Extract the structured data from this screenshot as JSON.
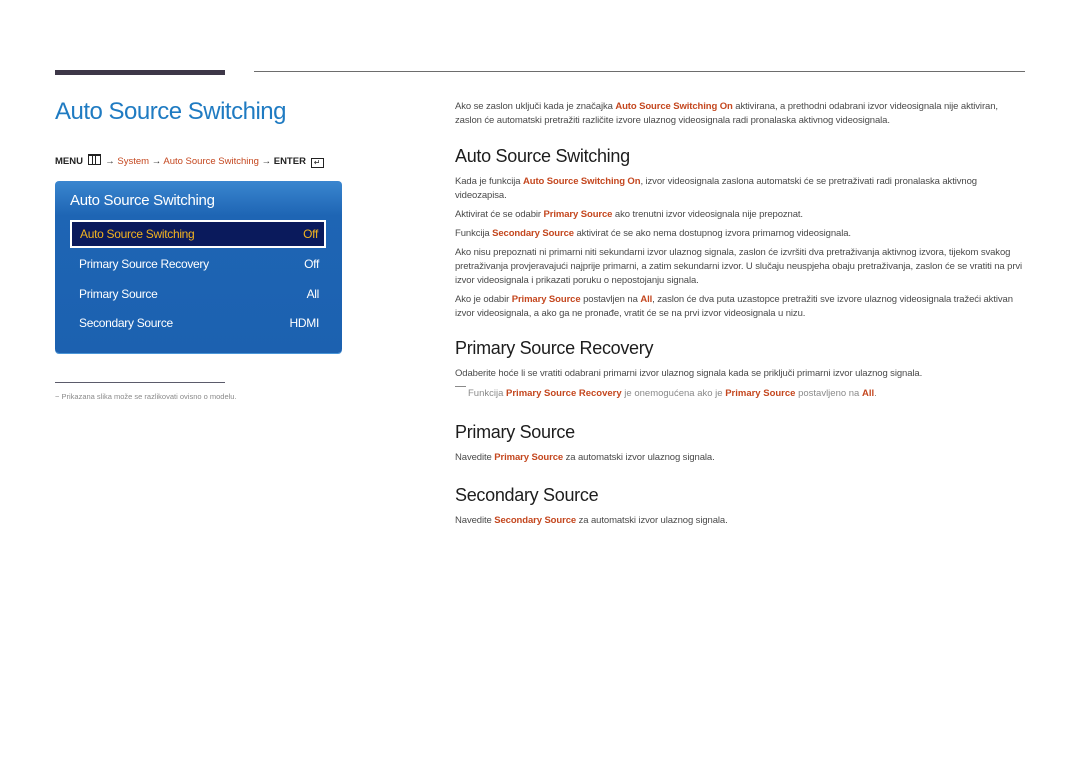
{
  "page": {
    "title": "Auto Source Switching",
    "menu_path": {
      "menu": "MENU",
      "menu_icon": "menu-grid-icon",
      "arrow": "→",
      "system": "System",
      "item": "Auto Source Switching",
      "enter": "ENTER",
      "enter_icon": "enter-return-icon",
      "enter_glyph": "↵"
    }
  },
  "osd": {
    "title": "Auto Source Switching",
    "rows": [
      {
        "label": "Auto Source Switching",
        "value": "Off",
        "selected": true
      },
      {
        "label": "Primary Source Recovery",
        "value": "Off",
        "selected": false
      },
      {
        "label": "Primary Source",
        "value": "All",
        "selected": false
      },
      {
        "label": "Secondary Source",
        "value": "HDMI",
        "selected": false
      }
    ],
    "colors": {
      "panel": "#1e65b4",
      "selected_bg": "#0a1a5c",
      "selected_text": "#f3b320"
    }
  },
  "footnote": "Prikazana slika može se razlikovati ovisno o modelu.",
  "footnote_dash": "−",
  "content": {
    "intro": {
      "t1": "Ako se zaslon uključi kada je značajka ",
      "h1": "Auto Source Switching On",
      "t2": " aktivirana, a prethodni odabrani izvor videosignala nije aktiviran, zaslon će automatski pretražiti različite izvore ulaznog videosignala radi pronalaska aktivnog videosignala."
    },
    "sections": {
      "ass": {
        "heading": "Auto Source Switching",
        "p1": {
          "t1": "Kada je funkcija ",
          "h1": "Auto Source Switching On",
          "t2": ", izvor videosignala zaslona automatski će se pretraživati radi pronalaska aktivnog videozapisa."
        },
        "p2": {
          "t1": "Aktivirat će se odabir ",
          "h1": "Primary Source",
          "t2": " ako trenutni izvor videosignala nije prepoznat."
        },
        "p3": {
          "t1": "Funkcija ",
          "h1": "Secondary Source",
          "t2": " aktivirat će se ako nema dostupnog izvora primarnog videosignala."
        },
        "p4": {
          "t1": "Ako nisu prepoznati ni primarni niti sekundarni izvor ulaznog signala, zaslon će izvršiti dva pretraživanja aktivnog izvora, tijekom svakog pretraživanja provjeravajući najprije primarni, a zatim sekundarni izvor. U slučaju neuspjeha obaju pretraživanja, zaslon će se vratiti na prvi izvor videosignala i prikazati poruku o nepostojanju signala."
        },
        "p5": {
          "t1": "Ako je odabir ",
          "h1": "Primary Source",
          "t2": " postavljen na ",
          "h2": "All",
          "t3": ", zaslon će dva puta uzastopce pretražiti sve izvore ulaznog videosignala tražeći aktivan izvor videosignala, a ako ga ne pronađe, vratit će se na prvi izvor videosignala u nizu."
        }
      },
      "psr": {
        "heading": "Primary Source Recovery",
        "p1": {
          "t1": "Odaberite hoće li se vratiti odabrani primarni izvor ulaznog signala kada se priključi primarni izvor ulaznog signala."
        },
        "note": {
          "t1": "Funkcija ",
          "h1": "Primary Source Recovery",
          "t2": " je onemogućena ako je ",
          "h2": "Primary Source",
          "t3": " postavljeno na ",
          "h3": "All",
          "t4": "."
        }
      },
      "ps": {
        "heading": "Primary Source",
        "p1": {
          "t1": "Navedite ",
          "h1": "Primary Source",
          "t2": " za automatski izvor ulaznog signala."
        }
      },
      "ss": {
        "heading": "Secondary Source",
        "p1": {
          "t1": "Navedite ",
          "h1": "Secondary Source",
          "t2": " za automatski izvor ulaznog signala."
        }
      }
    },
    "accent_color": "#c4471f",
    "title_color": "#1f7bc2"
  }
}
